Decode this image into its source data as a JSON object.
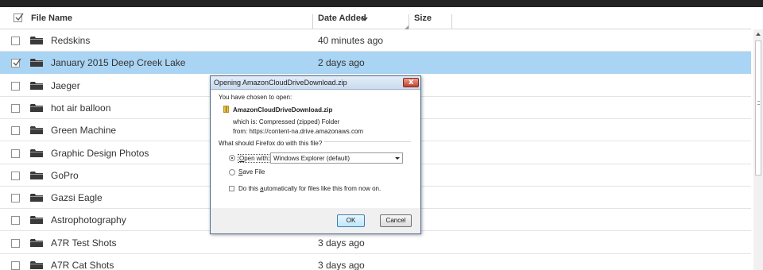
{
  "header": {
    "file_name": "File Name",
    "date_added": "Date Added",
    "sort_icon": "chevron-down-icon",
    "size": "Size"
  },
  "rows": [
    {
      "name": "Redskins",
      "date": "40 minutes ago",
      "selected": false
    },
    {
      "name": "January 2015 Deep Creek Lake",
      "date": "2 days ago",
      "selected": true
    },
    {
      "name": "Jaeger",
      "date": "",
      "selected": false
    },
    {
      "name": "hot air balloon",
      "date": "",
      "selected": false
    },
    {
      "name": "Green Machine",
      "date": "",
      "selected": false
    },
    {
      "name": "Graphic Design Photos",
      "date": "",
      "selected": false
    },
    {
      "name": "GoPro",
      "date": "",
      "selected": false
    },
    {
      "name": "Gazsi Eagle",
      "date": "",
      "selected": false
    },
    {
      "name": "Astrophotography",
      "date": "",
      "selected": false
    },
    {
      "name": "A7R Test Shots",
      "date": "3 days ago",
      "selected": false
    },
    {
      "name": "A7R Cat Shots",
      "date": "3 days ago",
      "selected": false
    }
  ],
  "dialog": {
    "title": "Opening AmazonCloudDriveDownload.zip",
    "intro": "You have chosen to open:",
    "filename": "AmazonCloudDriveDownload.zip",
    "which_is": "which is:  Compressed (zipped) Folder",
    "from": "from:  https://content-na.drive.amazonaws.com",
    "question": "What should Firefox do with this file?",
    "open_with_prefix": "",
    "open_with_underlined": "O",
    "open_with_rest": "pen with",
    "open_with_value": "Windows Explorer (default)",
    "save_file_underlined": "S",
    "save_file_rest": "ave File",
    "auto_underlined": "Do this ",
    "auto_underlined_a": "a",
    "auto_rest": "utomatically for files like this from now on.",
    "ok": "OK",
    "cancel": "Cancel",
    "close_glyph": "x"
  },
  "colors": {
    "selected_row": "#aad4f3",
    "topbar": "#232323",
    "dialog_border": "#4d6e96"
  }
}
